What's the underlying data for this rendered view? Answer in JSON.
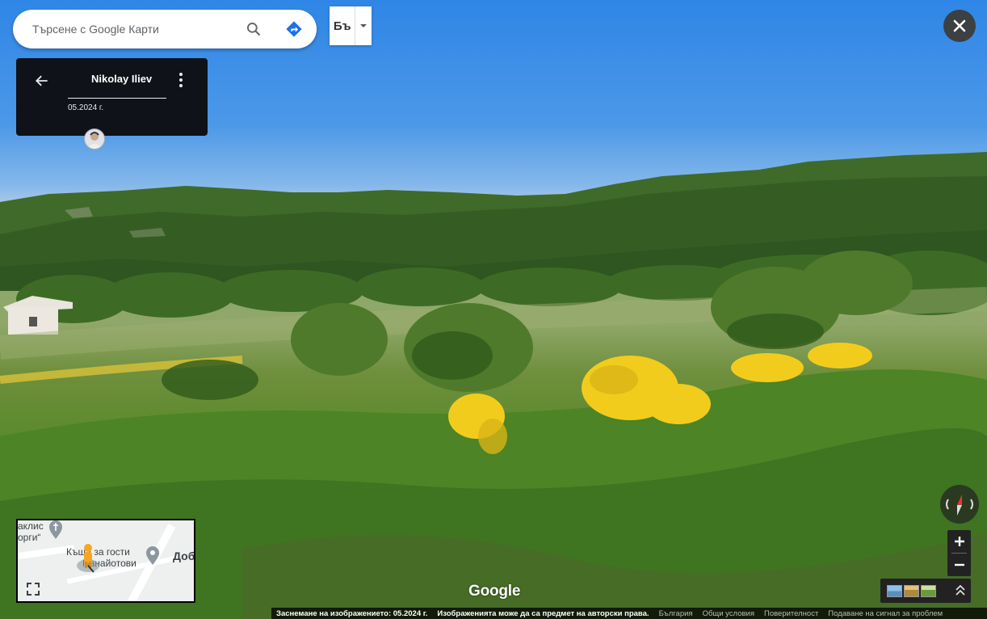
{
  "search": {
    "placeholder": "Търсене с Google Карти",
    "search_icon": "search-icon",
    "directions_icon": "directions-icon"
  },
  "language_toggle": {
    "label": "Бъ"
  },
  "info_card": {
    "author": "Nikolay Iliev",
    "capture_date": "05.2024 г."
  },
  "minimap": {
    "labels": [
      {
        "text": "аклис"
      },
      {
        "text": "орги“"
      },
      {
        "text": "Къща за гости"
      },
      {
        "text": "Панайотови"
      },
      {
        "text": "Доб"
      }
    ]
  },
  "logo": "Google",
  "footer": {
    "capture": "Заснемане на изображението: 05.2024 г.",
    "copyright": "Изображенията може да са предмет на авторски права.",
    "country": "България",
    "terms": "Общи условия",
    "privacy": "Поверителност",
    "report": "Подаване на сигнал за проблем"
  },
  "colors": {
    "sky": "#4b98e8",
    "card_bg": "#0f1219",
    "directions_blue": "#1a73e8",
    "compass_red": "#e53935"
  }
}
